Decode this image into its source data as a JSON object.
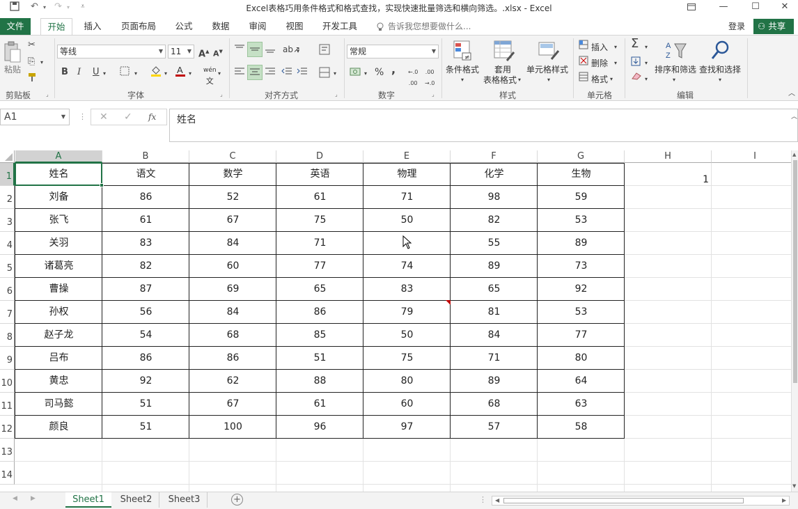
{
  "window": {
    "title": "Excel表格巧用条件格式和格式查找，实现快速批量筛选和横向筛选。.xlsx - Excel"
  },
  "ribbon_tabs": [
    "文件",
    "开始",
    "插入",
    "页面布局",
    "公式",
    "数据",
    "审阅",
    "视图",
    "开发工具"
  ],
  "tell_me": "告诉我您想要做什么...",
  "account": {
    "login": "登录",
    "share": "共享"
  },
  "ribbon": {
    "clipboard": {
      "paste": "粘贴",
      "label": "剪贴板"
    },
    "font": {
      "name": "等线",
      "size": "11",
      "label": "字体",
      "bold": "B",
      "italic": "I",
      "underline": "U",
      "phonetic": "wén"
    },
    "alignment": {
      "label": "对齐方式"
    },
    "number": {
      "format": "常规",
      "label": "数字",
      "percent": "%",
      "comma": ","
    },
    "styles": {
      "conditional": "条件格式",
      "table_format_1": "套用",
      "table_format_2": "表格格式",
      "cell_styles": "单元格样式",
      "label": "样式"
    },
    "cells": {
      "insert": "插入",
      "delete": "删除",
      "format": "格式",
      "label": "单元格"
    },
    "editing": {
      "sort_filter": "排序和筛选",
      "find_select": "查找和选择",
      "label": "编辑"
    }
  },
  "formula_bar": {
    "name_box": "A1",
    "fx": "fx",
    "content": "姓名"
  },
  "columns": [
    "A",
    "B",
    "C",
    "D",
    "E",
    "F",
    "G",
    "H",
    "I"
  ],
  "rows": [
    "1",
    "2",
    "3",
    "4",
    "5",
    "6",
    "7",
    "8",
    "9",
    "10",
    "11",
    "12",
    "13",
    "14"
  ],
  "table": {
    "header": [
      "姓名",
      "语文",
      "数学",
      "英语",
      "物理",
      "化学",
      "生物"
    ],
    "data": [
      [
        "刘备",
        "86",
        "52",
        "61",
        "71",
        "98",
        "59"
      ],
      [
        "张飞",
        "61",
        "67",
        "75",
        "50",
        "82",
        "53"
      ],
      [
        "关羽",
        "83",
        "84",
        "71",
        "",
        "55",
        "89"
      ],
      [
        "诸葛亮",
        "82",
        "60",
        "77",
        "74",
        "89",
        "73"
      ],
      [
        "曹操",
        "87",
        "69",
        "65",
        "83",
        "65",
        "92"
      ],
      [
        "孙权",
        "56",
        "84",
        "86",
        "79",
        "81",
        "53"
      ],
      [
        "赵子龙",
        "54",
        "68",
        "85",
        "50",
        "84",
        "77"
      ],
      [
        "吕布",
        "86",
        "86",
        "51",
        "75",
        "71",
        "80"
      ],
      [
        "黄忠",
        "92",
        "62",
        "88",
        "80",
        "89",
        "64"
      ],
      [
        "司马懿",
        "51",
        "67",
        "61",
        "60",
        "68",
        "63"
      ],
      [
        "颜良",
        "51",
        "100",
        "96",
        "97",
        "57",
        "58"
      ]
    ]
  },
  "h1_value": "1",
  "sheets": [
    "Sheet1",
    "Sheet2",
    "Sheet3"
  ],
  "active_sheet": "Sheet1",
  "colors": {
    "accent": "#217346"
  }
}
